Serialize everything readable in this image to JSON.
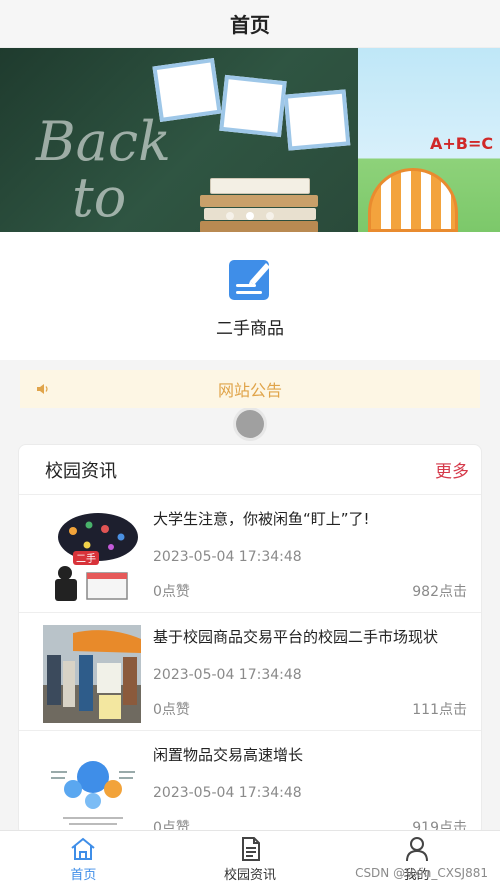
{
  "header": {
    "title": "首页"
  },
  "banner": {
    "chalk_text_1": "Back",
    "chalk_text_2": "to",
    "abc_text": "A+B=C",
    "active_index": 1
  },
  "menu": {
    "items": [
      {
        "label": "二手商品",
        "icon": "note-edit-icon"
      }
    ]
  },
  "notice": {
    "label": "网站公告"
  },
  "news": {
    "title": "校园资讯",
    "more": "更多",
    "items": [
      {
        "title": "大学生注意，你被闲鱼“盯上”了!",
        "date": "2023-05-04 17:34:48",
        "likes": "0点赞",
        "clicks": "982点击"
      },
      {
        "title": "基于校园商品交易平台的校园二手市场现状",
        "date": "2023-05-04 17:34:48",
        "likes": "0点赞",
        "clicks": "111点击"
      },
      {
        "title": "闲置物品交易高速增长",
        "date": "2023-05-04 17:34:48",
        "likes": "0点赞",
        "clicks": "919点击"
      }
    ]
  },
  "tabbar": {
    "items": [
      {
        "label": "首页",
        "icon": "home-icon",
        "active": true
      },
      {
        "label": "校园资讯",
        "icon": "document-icon",
        "active": false
      },
      {
        "label": "我的",
        "icon": "user-icon",
        "active": false
      }
    ]
  },
  "watermark": "CSDN @Vxin_CXSJ881",
  "colors": {
    "accent": "#3f8ee8",
    "more": "#d5394a",
    "notice_text": "#e0a44a",
    "notice_bg": "#fdf6e4"
  }
}
